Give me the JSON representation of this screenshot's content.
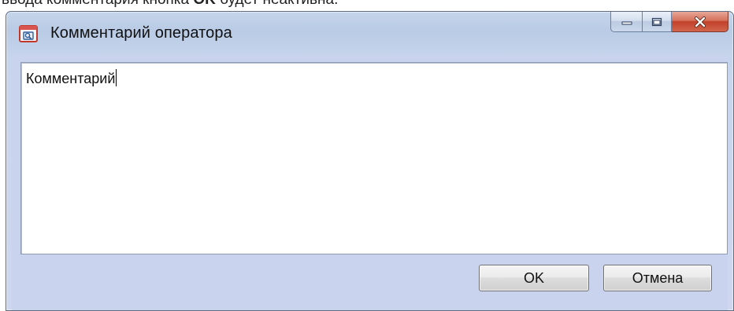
{
  "page": {
    "text_before": "ввода комментария кнопка ",
    "text_bold": "OK",
    "text_after": " будет неактивна."
  },
  "window": {
    "title": "Комментарий оператора",
    "icon": "app-window-icon"
  },
  "comment": {
    "value": "Комментарий"
  },
  "buttons": {
    "ok_label": "OK",
    "cancel_label": "Отмена"
  },
  "colors": {
    "frame": "#c5d5ea",
    "client": "#c9d3ee",
    "close_button": "#c2412a"
  }
}
